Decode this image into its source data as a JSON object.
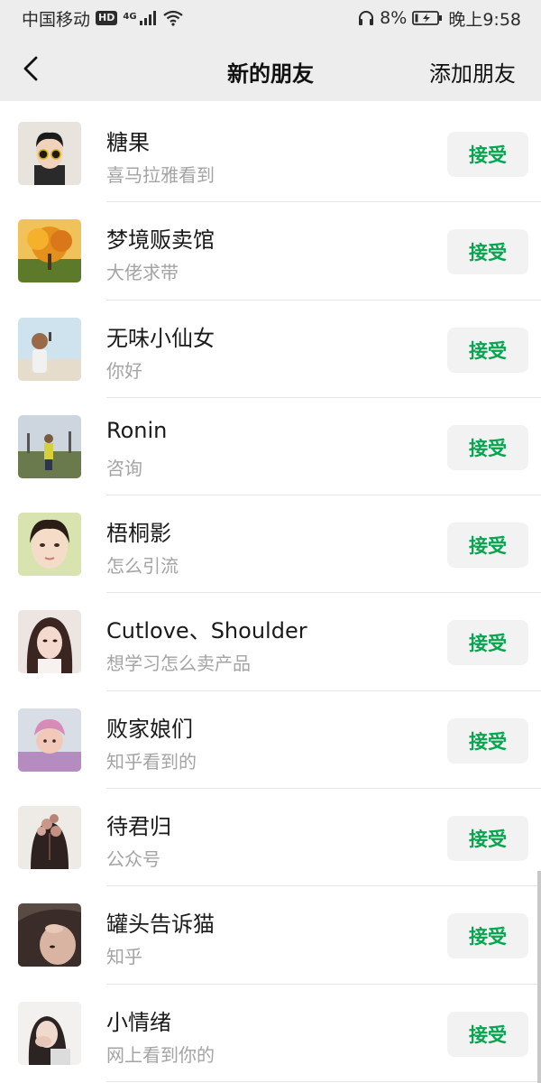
{
  "status_bar": {
    "carrier": "中国移动",
    "hd": "HD",
    "network": "4G",
    "battery_percent": "8%",
    "time": "晚上9:58"
  },
  "nav": {
    "title": "新的朋友",
    "action": "添加朋友"
  },
  "requests": [
    {
      "name": "糖果",
      "message": "喜马拉雅看到",
      "button": "接受",
      "avatar": "avatar-glasses-man"
    },
    {
      "name": "梦境贩卖馆",
      "message": "大佬求带",
      "button": "接受",
      "avatar": "avatar-autumn-tree"
    },
    {
      "name": "无味小仙女",
      "message": "你好",
      "button": "接受",
      "avatar": "avatar-girl-beach"
    },
    {
      "name": "Ronin",
      "message": "咨询",
      "button": "接受",
      "avatar": "avatar-field-person"
    },
    {
      "name": "梧桐影",
      "message": "怎么引流",
      "button": "接受",
      "avatar": "avatar-woman-face"
    },
    {
      "name": "Cutlove、Shoulder",
      "message": "想学习怎么卖产品",
      "button": "接受",
      "avatar": "avatar-woman-portrait"
    },
    {
      "name": "败家娘们",
      "message": "知乎看到的",
      "button": "接受",
      "avatar": "avatar-baby"
    },
    {
      "name": "待君归",
      "message": "公众号",
      "button": "接受",
      "avatar": "avatar-woman-flowers"
    },
    {
      "name": "罐头告诉猫",
      "message": "知乎",
      "button": "接受",
      "avatar": "avatar-woman-closeup"
    },
    {
      "name": "小情绪",
      "message": "网上看到你的",
      "button": "接受",
      "avatar": "avatar-girl-hand"
    }
  ],
  "colors": {
    "accept_text": "#07a550",
    "accept_bg": "#f2f2f2",
    "header_bg": "#ededed"
  }
}
